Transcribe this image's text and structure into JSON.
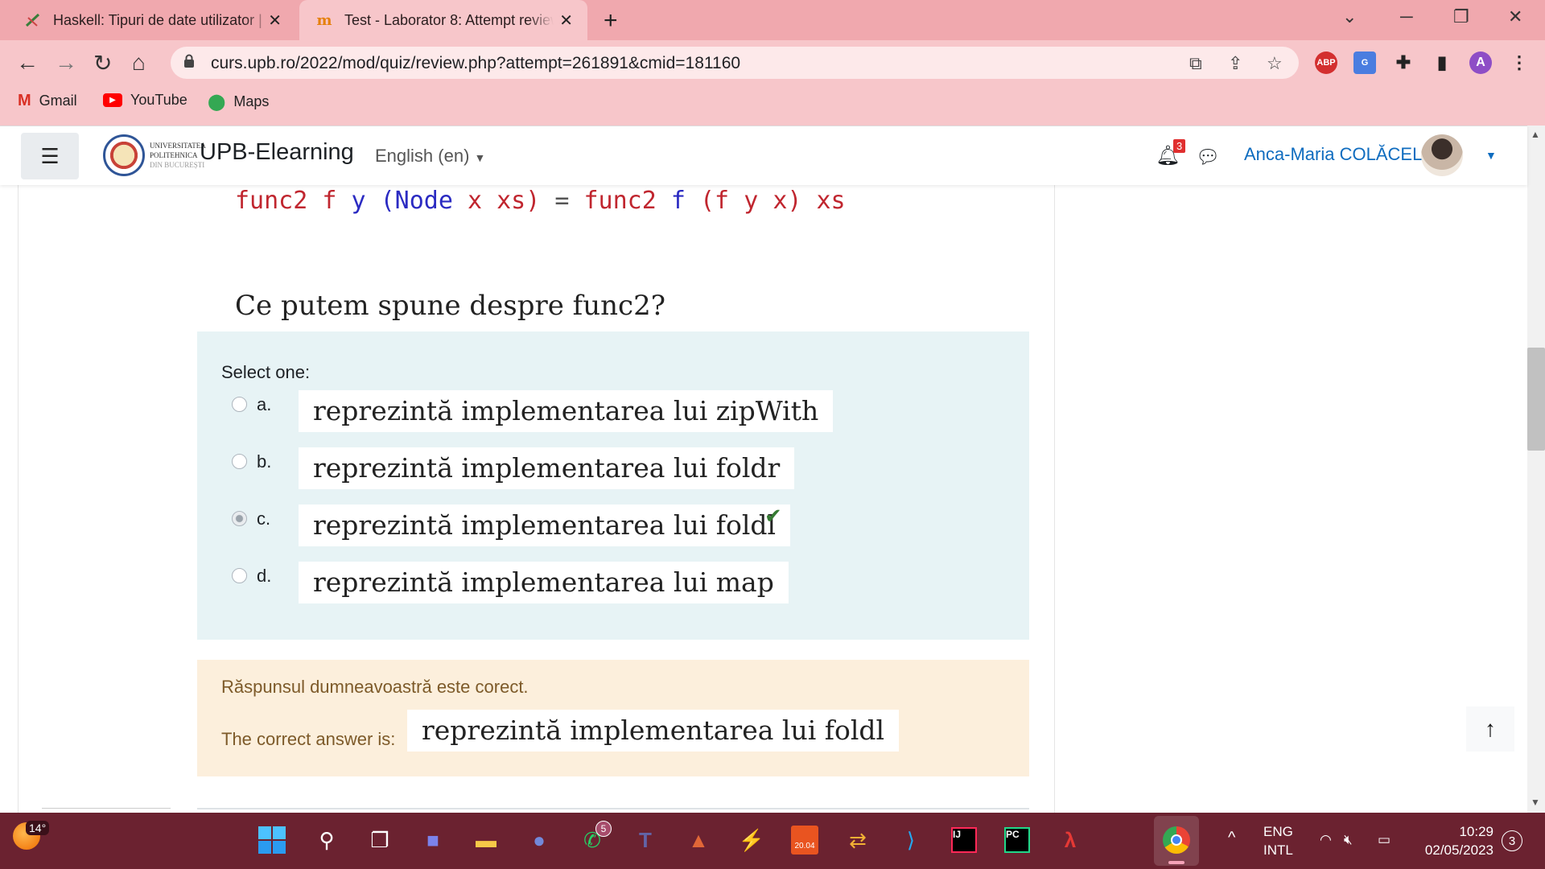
{
  "browser": {
    "tabs": [
      {
        "title": "Haskell: Tipuri de date utilizator | ",
        "active": false
      },
      {
        "title": "Test - Laborator 8: Attempt review",
        "active": true
      }
    ],
    "url": "curs.upb.ro/2022/mod/quiz/review.php?attempt=261891&cmid=181160",
    "bookmarks": [
      "Gmail",
      "YouTube",
      "Maps"
    ],
    "profile_initial": "A",
    "abp_label": "ABP"
  },
  "header": {
    "logo_text": [
      "UNIVERSITATEA",
      "POLITEHNICA",
      "DIN BUCUREȘTI"
    ],
    "site_name": "UPB-Elearning",
    "language": "English (en)",
    "notification_count": "3",
    "user_name": "Anca-Maria COLĂCEL"
  },
  "question": {
    "code_tokens": {
      "t1": "func2",
      "t2": "f",
      "t3": "y",
      "t4": "(Node",
      "t5": "x",
      "t6": "xs)",
      "t7": "=",
      "t8": "func2",
      "t9": "f",
      "t10": "(f",
      "t11": "y",
      "t12": "x)",
      "t13": "xs"
    },
    "prompt": "Ce putem spune despre func2?",
    "select_label": "Select one:",
    "options": [
      {
        "letter": "a.",
        "text": "reprezintă implementarea lui zipWith",
        "selected": false
      },
      {
        "letter": "b.",
        "text": "reprezintă implementarea lui foldr",
        "selected": false
      },
      {
        "letter": "c.",
        "text": "reprezintă implementarea lui foldl",
        "selected": true
      },
      {
        "letter": "d.",
        "text": "reprezintă implementarea lui map",
        "selected": false
      }
    ]
  },
  "feedback": {
    "message": "Răspunsul dumneavoastră este corect.",
    "correct_label": "The correct answer is:",
    "correct_answer": "reprezintă implementarea lui foldl"
  },
  "taskbar": {
    "temperature": "14°",
    "whatsapp_badge": "5",
    "ubuntu_label": "20.04",
    "lang_line1": "ENG",
    "lang_line2": "INTL",
    "time": "10:29",
    "date": "02/05/2023",
    "notifications": "3"
  },
  "colors": {
    "tabstrip": "#f0a8ae",
    "toolbar": "#f7c6ca",
    "link": "#0f6cbf",
    "answer_bg": "#e7f3f5",
    "feedback_bg": "#fcefdc",
    "correct_check": "#357a32",
    "taskbar": "#6b2230"
  }
}
